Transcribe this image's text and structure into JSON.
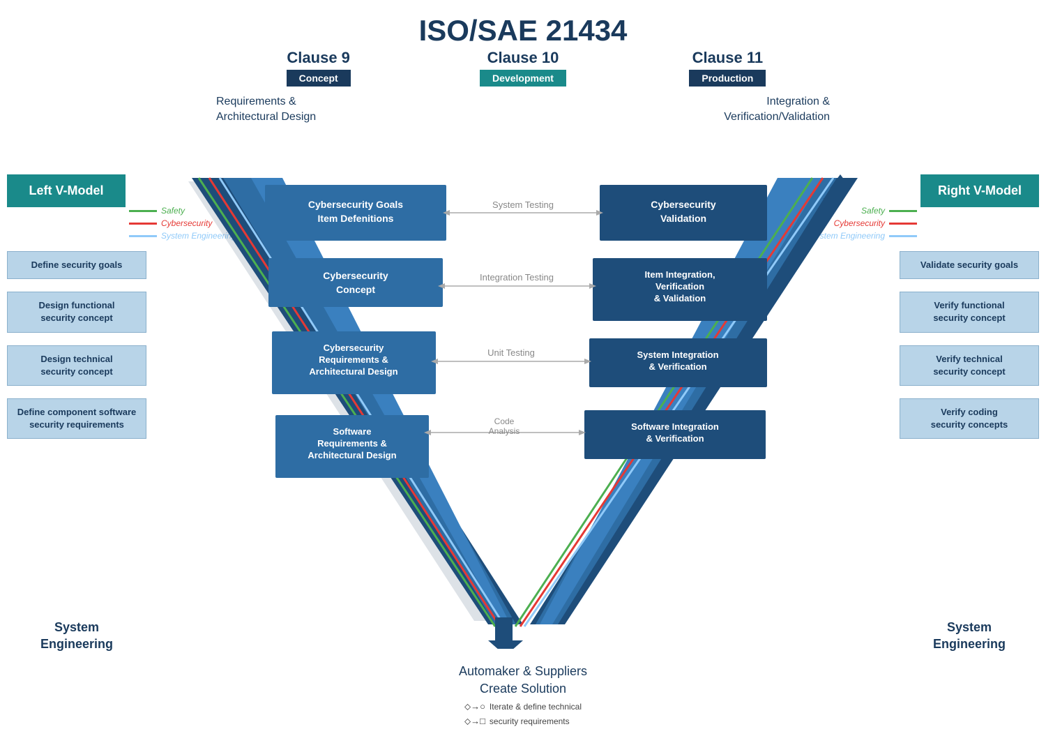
{
  "title": "ISO/SAE 21434",
  "clauses": [
    {
      "number": "Clause 9",
      "label": "Concept"
    },
    {
      "number": "Clause 10",
      "label": "Development"
    },
    {
      "number": "Clause 11",
      "label": "Production"
    }
  ],
  "subHeaderLeft": "Requirements &\nArchitectural Design",
  "subHeaderRight": "Integration &\nVerification/Validation",
  "vModelLeft": "Left V-Model",
  "vModelRight": "Right V-Model",
  "leftBoxes": [
    "Define security goals",
    "Design functional\nsecurity concept",
    "Design technical\nsecurity concept",
    "Define component software\nsecurity requirements"
  ],
  "rightBoxes": [
    "Validate security goals",
    "Verify functional\nsecurity concept",
    "Verify technical\nsecurity concept",
    "Verify coding\nsecurity concepts"
  ],
  "sysEngLeft": "System\nEngineering",
  "sysEngRight": "System\nEngineering",
  "legendLeft": {
    "safety": "Safety",
    "cybersecurity": "Cybersecurity",
    "systemEngineering": "System Engineering"
  },
  "vDiagram": {
    "leftItems": [
      "Cybersecurity Goals\nItem Defenitions",
      "Cybersecurity\nConcept",
      "Cybersecurity\nRequirements &\nArchitectural Design",
      "Software\nRequirements &\nArchitectural Design"
    ],
    "rightItems": [
      "Cybersecurity\nValidation",
      "Item Integration,\nVerification\n& Validation",
      "System Integration\n& Verification",
      "Software Integration\n& Verification"
    ],
    "centerLabels": [
      "System Testing",
      "Integration Testing",
      "Unit Testing",
      "Code\nAnalysis"
    ]
  },
  "bottomLabel": "Automaker & Suppliers\nCreate Solution",
  "bottomLegend": [
    "Iterate & define technical",
    "security requirements"
  ]
}
